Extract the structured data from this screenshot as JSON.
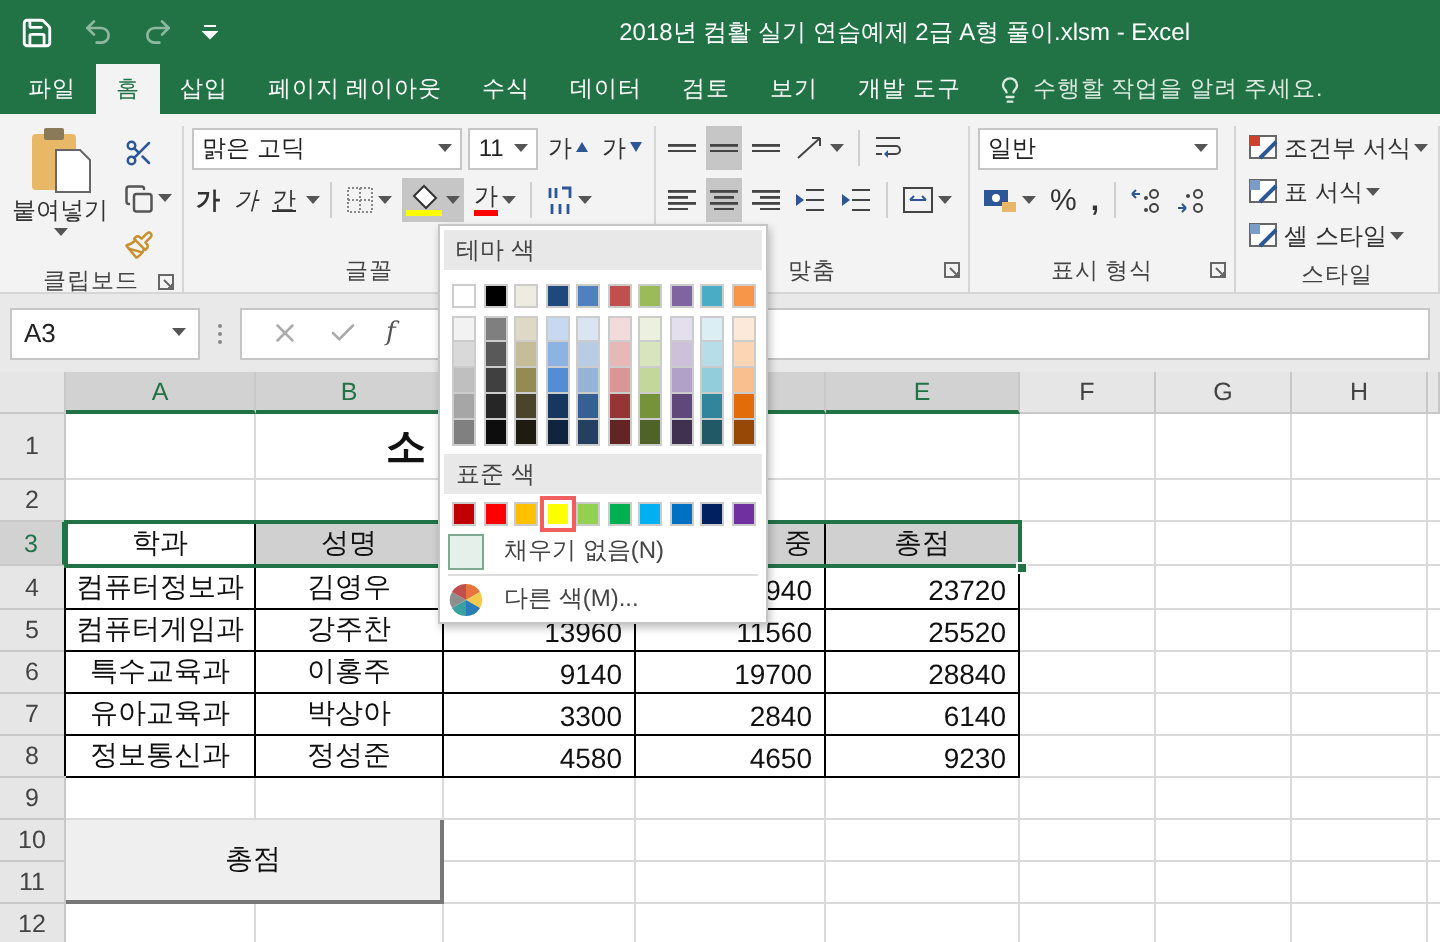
{
  "window": {
    "title": "2018년 컴활 실기 연습예제 2급 A형 풀이.xlsm - Excel"
  },
  "tabs": [
    {
      "label": "파일",
      "selected": false
    },
    {
      "label": "홈",
      "selected": true
    },
    {
      "label": "삽입",
      "selected": false
    },
    {
      "label": "페이지 레이아웃",
      "selected": false
    },
    {
      "label": "수식",
      "selected": false
    },
    {
      "label": "데이터",
      "selected": false
    },
    {
      "label": "검토",
      "selected": false
    },
    {
      "label": "보기",
      "selected": false
    },
    {
      "label": "개발 도구",
      "selected": false
    }
  ],
  "tell_me": "수행할 작업을 알려 주세요.",
  "ribbon": {
    "clipboard": {
      "paste": "붙여넣기",
      "label": "클립보드"
    },
    "font": {
      "name": "맑은 고딕",
      "size": "11",
      "grow": "가",
      "shrink": "가",
      "bold": "가",
      "italic": "가",
      "underline": "간",
      "font_color": "가",
      "label": "글꼴"
    },
    "alignment": {
      "vertical": [
        {
          "selected": false
        },
        {
          "selected": true
        },
        {
          "selected": false
        }
      ],
      "horizontal": [
        {
          "selected": false
        },
        {
          "selected": true
        },
        {
          "selected": false
        }
      ],
      "label": "맞춤"
    },
    "number": {
      "format": "일반",
      "percent": "%",
      "comma": ",",
      "label": "표시 형식"
    },
    "styles": {
      "items": [
        "조건부 서식",
        "표 서식",
        "셀 스타일"
      ],
      "label": "스타일"
    }
  },
  "formula_bar": {
    "name_box": "A3",
    "function_label": "f"
  },
  "fill_menu": {
    "theme_label": "테마 색",
    "theme": [
      {
        "color": "#ffffff",
        "selected": false,
        "shades": [
          {
            "color": "#f2f2f2",
            "selected": false
          },
          {
            "color": "#d9d9d9",
            "selected": false
          },
          {
            "color": "#bfbfbf",
            "selected": false
          },
          {
            "color": "#a6a6a6",
            "selected": false
          },
          {
            "color": "#808080",
            "selected": false
          }
        ]
      },
      {
        "color": "#000000",
        "selected": false,
        "shades": [
          {
            "color": "#7f7f7f",
            "selected": false
          },
          {
            "color": "#595959",
            "selected": false
          },
          {
            "color": "#404040",
            "selected": false
          },
          {
            "color": "#262626",
            "selected": false
          },
          {
            "color": "#0d0d0d",
            "selected": false
          }
        ]
      },
      {
        "color": "#eeece1",
        "selected": false,
        "shades": [
          {
            "color": "#ddd9c4",
            "selected": false
          },
          {
            "color": "#c4bd97",
            "selected": false
          },
          {
            "color": "#948a54",
            "selected": false
          },
          {
            "color": "#4a452a",
            "selected": false
          },
          {
            "color": "#1e1c11",
            "selected": false
          }
        ]
      },
      {
        "color": "#1f497d",
        "selected": false,
        "shades": [
          {
            "color": "#c6d9f1",
            "selected": false
          },
          {
            "color": "#8db3e2",
            "selected": false
          },
          {
            "color": "#548dd4",
            "selected": false
          },
          {
            "color": "#17375e",
            "selected": false
          },
          {
            "color": "#0f243e",
            "selected": false
          }
        ]
      },
      {
        "color": "#4f81bd",
        "selected": false,
        "shades": [
          {
            "color": "#dbe5f1",
            "selected": false
          },
          {
            "color": "#b8cce4",
            "selected": false
          },
          {
            "color": "#95b3d7",
            "selected": false
          },
          {
            "color": "#366092",
            "selected": false
          },
          {
            "color": "#244061",
            "selected": false
          }
        ]
      },
      {
        "color": "#c0504d",
        "selected": false,
        "shades": [
          {
            "color": "#f2dcdb",
            "selected": false
          },
          {
            "color": "#e6b9b8",
            "selected": false
          },
          {
            "color": "#da9694",
            "selected": false
          },
          {
            "color": "#963634",
            "selected": false
          },
          {
            "color": "#632523",
            "selected": false
          }
        ]
      },
      {
        "color": "#9bbb59",
        "selected": false,
        "shades": [
          {
            "color": "#ebf1de",
            "selected": false
          },
          {
            "color": "#d8e4bc",
            "selected": false
          },
          {
            "color": "#c4d79b",
            "selected": false
          },
          {
            "color": "#76933c",
            "selected": false
          },
          {
            "color": "#4f6228",
            "selected": false
          }
        ]
      },
      {
        "color": "#8064a2",
        "selected": false,
        "shades": [
          {
            "color": "#e4dfec",
            "selected": false
          },
          {
            "color": "#ccc0da",
            "selected": false
          },
          {
            "color": "#b1a0c7",
            "selected": false
          },
          {
            "color": "#60497a",
            "selected": false
          },
          {
            "color": "#403151",
            "selected": false
          }
        ]
      },
      {
        "color": "#4bacc6",
        "selected": false,
        "shades": [
          {
            "color": "#dbeef4",
            "selected": false
          },
          {
            "color": "#b7dee8",
            "selected": false
          },
          {
            "color": "#92cddc",
            "selected": false
          },
          {
            "color": "#31869b",
            "selected": false
          },
          {
            "color": "#215967",
            "selected": false
          }
        ]
      },
      {
        "color": "#f79646",
        "selected": false,
        "shades": [
          {
            "color": "#fde9d9",
            "selected": false
          },
          {
            "color": "#fcd5b4",
            "selected": false
          },
          {
            "color": "#fabf8f",
            "selected": false
          },
          {
            "color": "#e26b0a",
            "selected": false
          },
          {
            "color": "#974706",
            "selected": false
          }
        ]
      }
    ],
    "standard_label": "표준 색",
    "standard": [
      {
        "color": "#c00000",
        "selected": false
      },
      {
        "color": "#ff0000",
        "selected": false
      },
      {
        "color": "#ffc000",
        "selected": false
      },
      {
        "color": "#ffff00",
        "selected": true
      },
      {
        "color": "#92d050",
        "selected": false
      },
      {
        "color": "#00b050",
        "selected": false
      },
      {
        "color": "#00b0f0",
        "selected": false
      },
      {
        "color": "#0070c0",
        "selected": false
      },
      {
        "color": "#002060",
        "selected": false
      },
      {
        "color": "#7030a0",
        "selected": false
      }
    ],
    "no_fill": "채우기 없음(N)",
    "more_colors": "다른 색(M)..."
  },
  "sheet": {
    "columns": [
      {
        "label": "A",
        "selected": true
      },
      {
        "label": "B",
        "selected": true
      },
      {
        "selected": true
      },
      {
        "label": "E",
        "selected": true
      },
      {
        "label": "F",
        "selected": false
      },
      {
        "label": "G",
        "selected": false
      },
      {
        "label": "H",
        "selected": false
      }
    ],
    "rows": [
      {
        "label": "1",
        "selected": false,
        "kind": "title",
        "title": "소"
      },
      {
        "label": "2",
        "selected": false,
        "kind": "blank"
      },
      {
        "label": "3",
        "selected": true,
        "kind": "header",
        "a_active": true,
        "a": "학과",
        "b": "성명",
        "d": "중",
        "e": "총점"
      },
      {
        "label": "4",
        "selected": false,
        "kind": "data",
        "a": "컴퓨터정보과",
        "b": "김영우",
        "d": "940",
        "e": "23720"
      },
      {
        "label": "5",
        "selected": false,
        "kind": "data",
        "a": "컴퓨터게임과",
        "b": "강주찬",
        "c": "13960",
        "d": "11560",
        "e": "25520"
      },
      {
        "label": "6",
        "selected": false,
        "kind": "data",
        "a": "특수교육과",
        "b": "이홍주",
        "c": "9140",
        "d": "19700",
        "e": "28840"
      },
      {
        "label": "7",
        "selected": false,
        "kind": "data",
        "a": "유아교육과",
        "b": "박상아",
        "c": "3300",
        "d": "2840",
        "e": "6140"
      },
      {
        "label": "8",
        "selected": false,
        "kind": "data",
        "a": "정보통신과",
        "b": "정성준",
        "c": "4580",
        "d": "4650",
        "e": "9230"
      },
      {
        "label": "9",
        "selected": false,
        "kind": "blank"
      },
      {
        "label": "10",
        "selected": false,
        "kind": "merged_box",
        "a": "총점"
      },
      {
        "label": "11",
        "selected": false,
        "kind": "blank"
      },
      {
        "label": "12",
        "selected": false,
        "kind": "blank"
      }
    ]
  }
}
